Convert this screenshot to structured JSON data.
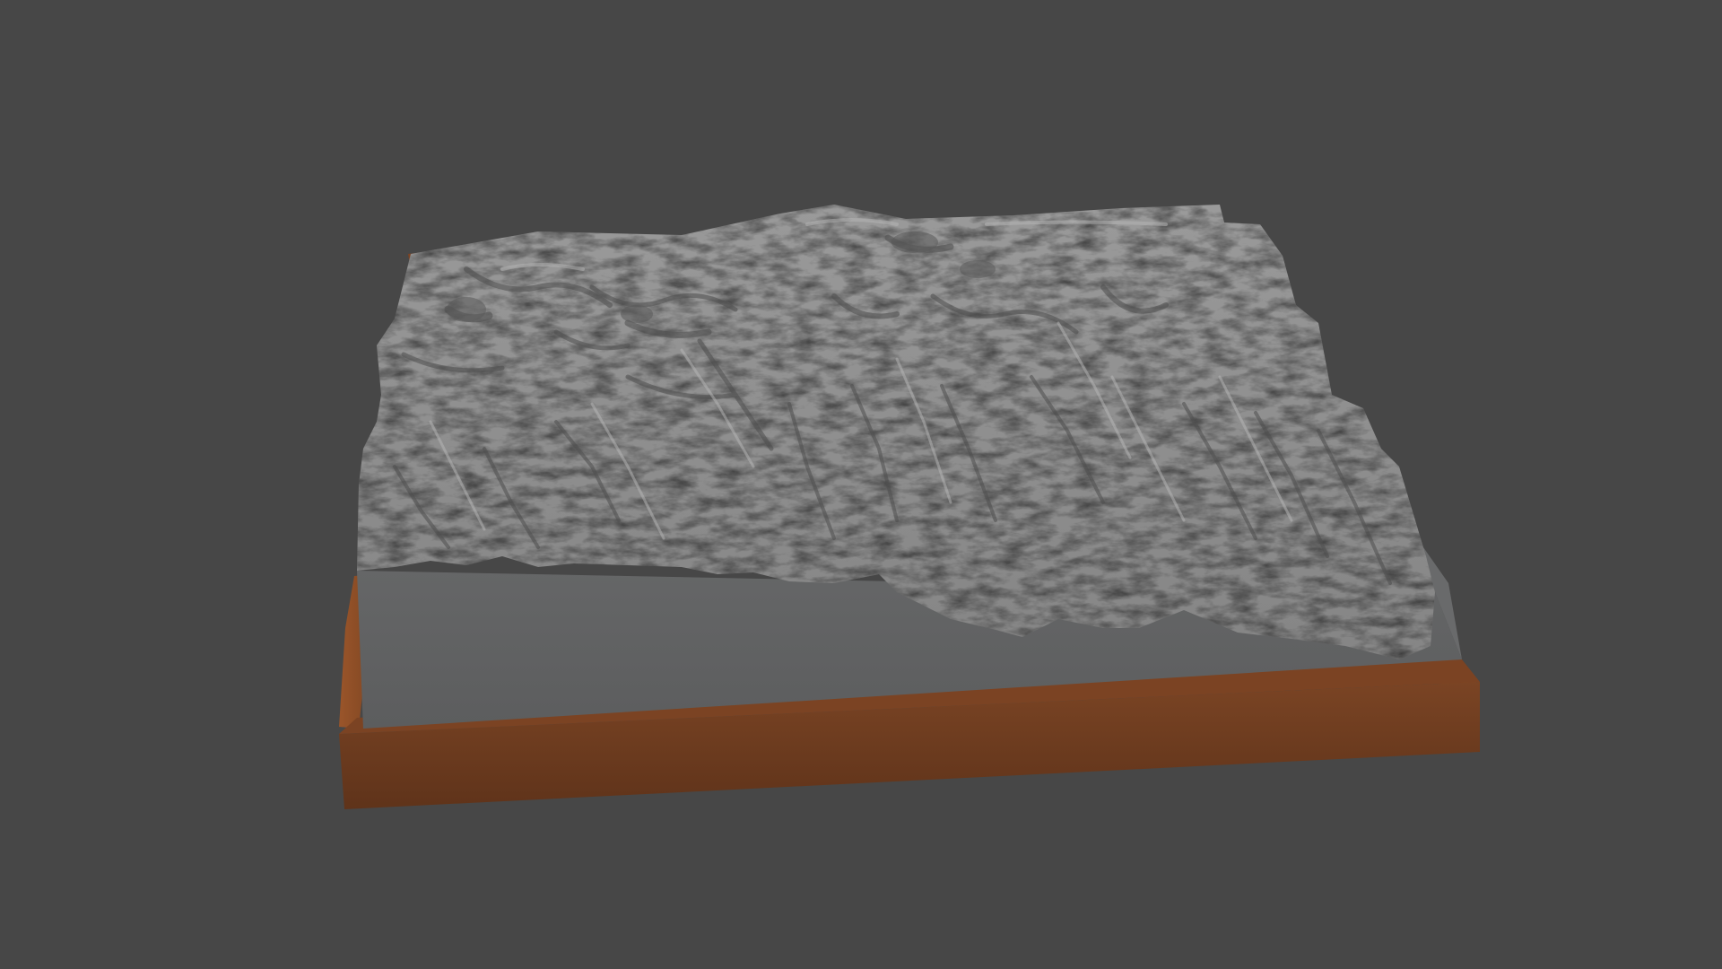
{
  "scene": {
    "background_color": "#474747",
    "subject": "terrain-relief-model",
    "terrain_color": "#8e8e8e",
    "terrain_side_color": "#5f6061",
    "base_front_color": "#6e3d20",
    "base_side_color": "#8a4a22",
    "base_top_color": "#7d4322"
  }
}
